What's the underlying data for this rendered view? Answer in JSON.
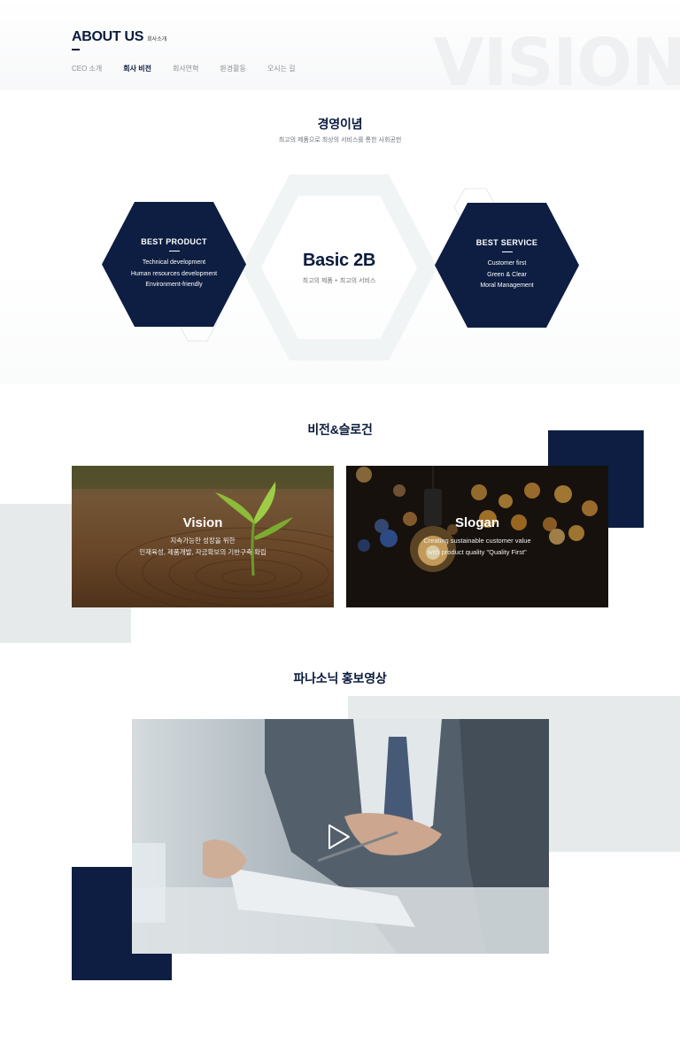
{
  "header": {
    "title": "ABOUT US",
    "subtitle": "회사소개",
    "bg_word": "VISION",
    "nav": [
      {
        "label": "CEO 소개",
        "active": false
      },
      {
        "label": "회사 비전",
        "active": true
      },
      {
        "label": "회사연혁",
        "active": false
      },
      {
        "label": "환경활동",
        "active": false
      },
      {
        "label": "오시는 길",
        "active": false
      }
    ]
  },
  "philosophy": {
    "title": "경영이념",
    "subtitle": "최고의 제품으로 최상의 서비스를 통한 사회공헌",
    "left": {
      "title": "BEST PRODUCT",
      "lines": [
        "Technical development",
        "Human resources development",
        "Environment-friendly"
      ]
    },
    "center": {
      "title": "Basic 2B",
      "subtitle": "최고의 제품 + 최고의 서비스"
    },
    "right": {
      "title": "BEST SERVICE",
      "lines": [
        "Customer first",
        "Green & Clear",
        "Moral Management"
      ]
    }
  },
  "vision": {
    "title": "비전&슬로건",
    "cards": [
      {
        "title": "Vision",
        "lines": [
          "지속가능한 성장을 위한",
          "인재육성, 제품개발, 자금확보의 기반구축 확립"
        ]
      },
      {
        "title": "Slogan",
        "lines": [
          "Creating sustainable customer value",
          "with product quality \"Quality First\""
        ]
      }
    ]
  },
  "video": {
    "title": "파나소닉 홍보영상",
    "play_icon": "play-icon"
  },
  "colors": {
    "navy": "#0d1e42",
    "light_grey": "#e6eaeb",
    "hex_outline": "#f1f4f5"
  }
}
